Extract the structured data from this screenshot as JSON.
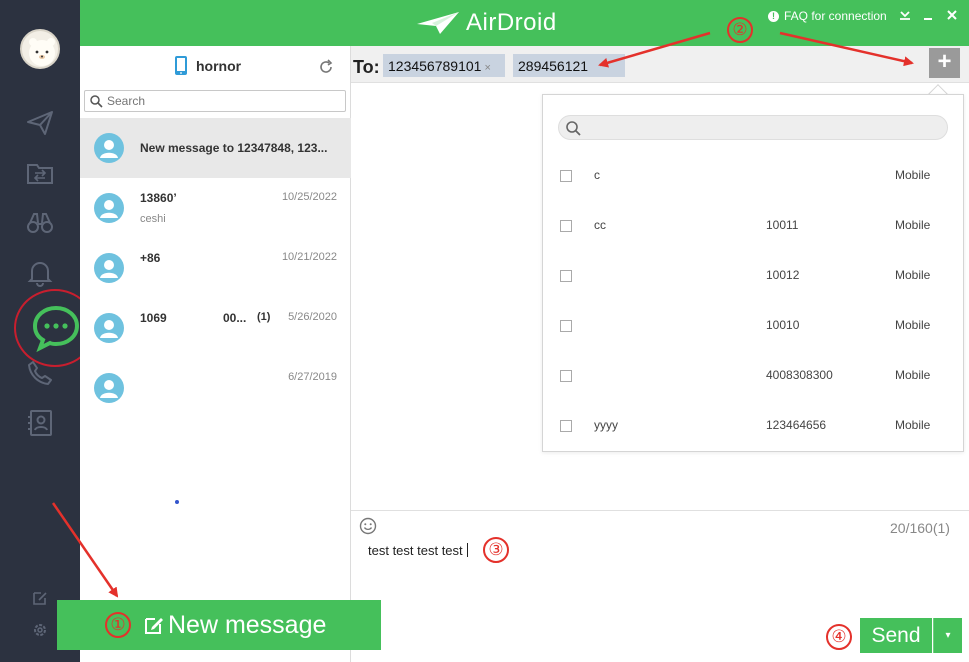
{
  "header": {
    "app_name": "AirDroid",
    "faq_label": "FAQ for connection",
    "brand_color": "#45c05b"
  },
  "sidebar": {
    "icons": [
      "send-icon",
      "file-transfer-icon",
      "binoculars-icon",
      "notification-bell-icon",
      "messages-icon",
      "call-icon",
      "contacts-icon"
    ],
    "bottom_icons": [
      "edit-icon",
      "settings-icon"
    ]
  },
  "device": {
    "name": "hornor"
  },
  "search": {
    "placeholder": "Search"
  },
  "conversations": [
    {
      "title": "New message to 12347848, 123...",
      "preview": "",
      "date": "",
      "count": ""
    },
    {
      "title": "13860’",
      "preview": "ceshi",
      "date": "10/25/2022",
      "count": ""
    },
    {
      "title": "+86",
      "preview": "",
      "date": "10/21/2022",
      "count": ""
    },
    {
      "title": "1069",
      "title_suffix": "00...",
      "preview": "",
      "date": "5/26/2020",
      "count": "(1)"
    },
    {
      "title": "",
      "preview": "",
      "date": "6/27/2019",
      "count": ""
    }
  ],
  "compose": {
    "to_label": "To:",
    "recipients": [
      "123456789101",
      "289456121"
    ],
    "chip_remove": "×",
    "add_label": "+",
    "counter": "20/160(1)",
    "message": "test test test test",
    "send_label": "Send",
    "dropdown_label": "▾"
  },
  "contacts": [
    {
      "name": "c",
      "number": "",
      "type": "Mobile"
    },
    {
      "name": "cc",
      "number": "10011",
      "type": "Mobile"
    },
    {
      "name": "",
      "number": "10012",
      "type": "Mobile"
    },
    {
      "name": "",
      "number": "10010",
      "type": "Mobile"
    },
    {
      "name": "",
      "number": "4008308300",
      "type": "Mobile"
    },
    {
      "name": "yyyy",
      "number": "123464656",
      "type": "Mobile"
    }
  ],
  "new_message": {
    "label": "New message"
  },
  "annotations": {
    "step1": "①",
    "step2": "②",
    "step3": "③",
    "step4": "④",
    "color": "#e4312b"
  }
}
